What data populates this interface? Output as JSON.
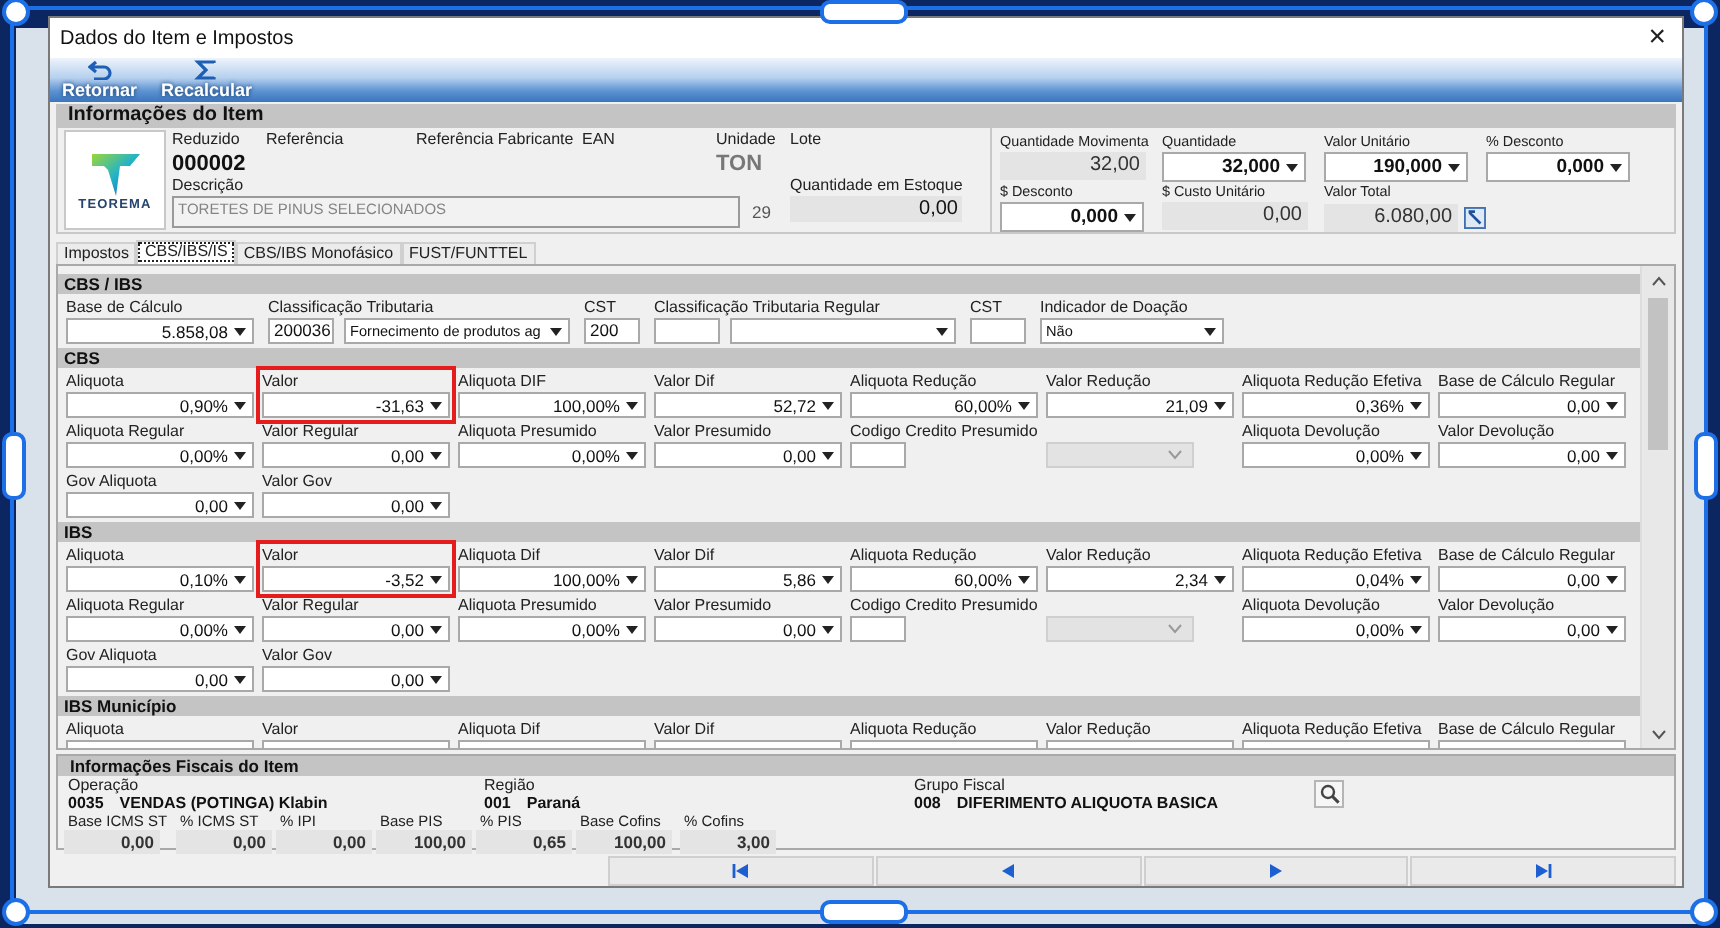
{
  "window": {
    "title": "Dados do Item e Impostos",
    "close": "×"
  },
  "toolbar": [
    {
      "label": "Retornar"
    },
    {
      "label": "Recalcular"
    }
  ],
  "item_info": {
    "title": "Informações do Item",
    "logo": "TEOREMA",
    "reduzido": {
      "label": "Reduzido",
      "value": "000002"
    },
    "referencia": {
      "label": "Referência"
    },
    "referencia_fabricante": {
      "label": "Referência Fabricante"
    },
    "ean": {
      "label": "EAN"
    },
    "unidade": {
      "label": "Unidade",
      "value": "TON"
    },
    "lote": {
      "label": "Lote"
    },
    "descricao": {
      "label": "Descrição",
      "value": "TORETES DE PINUS SELECIONADOS",
      "count": "29"
    },
    "estoque": {
      "label": "Quantidade em Estoque",
      "value": "0,00"
    },
    "amounts": [
      {
        "kind": "readonly",
        "label": "Quantidade Movimenta",
        "value": "32,00"
      },
      {
        "kind": "spin",
        "label": "Quantidade",
        "value": "32,000"
      },
      {
        "kind": "spin",
        "label": "Valor Unitário",
        "value": "190,000"
      },
      {
        "kind": "spin",
        "label": "% Desconto",
        "value": "0,000"
      },
      {
        "kind": "spin",
        "label": "$ Desconto",
        "value": "0,000"
      },
      {
        "kind": "readonly",
        "label": "$ Custo Unitário",
        "value": "0,00"
      },
      {
        "kind": "readonly_action",
        "label": "Valor Total",
        "value": "6.080,00"
      }
    ]
  },
  "tabs": [
    {
      "label": "Impostos",
      "selected": false
    },
    {
      "label": "CBS/IBS/IS",
      "selected": true
    },
    {
      "label": "CBS/IBS Monofásico",
      "selected": false
    },
    {
      "label": "FUST/FUNTTEL",
      "selected": false
    }
  ],
  "sections": [
    {
      "title": "CBS / IBS",
      "rows": [
        [
          {
            "kind": "spin",
            "label": "Base de Cálculo",
            "value": "5.858,08"
          },
          {
            "kind": "code_select",
            "label": "Classificação Tributaria",
            "code": "200036",
            "value": "Fornecimento de produtos ag"
          },
          {
            "kind": "text",
            "label": "CST",
            "value": "200"
          },
          {
            "kind": "code_select",
            "label": "Classificação Tributaria Regular"
          },
          {
            "kind": "text",
            "label": "CST"
          },
          {
            "kind": "select",
            "label": "Indicador de Doação",
            "value": "Não"
          }
        ]
      ]
    },
    {
      "title": "CBS",
      "rows": [
        [
          {
            "kind": "spin",
            "label": "Aliquota",
            "value": "0,90%"
          },
          {
            "kind": "spin",
            "label": "Valor",
            "value": "-31,63",
            "highlighted": true
          },
          {
            "kind": "spin",
            "label": "Aliquota DIF",
            "value": "100,00%"
          },
          {
            "kind": "spin",
            "label": "Valor Dif",
            "value": "52,72"
          },
          {
            "kind": "spin",
            "label": "Aliquota Redução",
            "value": "60,00%"
          },
          {
            "kind": "spin",
            "label": "Valor Redução",
            "value": "21,09"
          },
          {
            "kind": "spin",
            "label": "Aliquota Redução Efetiva",
            "value": "0,36%"
          },
          {
            "kind": "spin",
            "label": "Base de Cálculo Regular",
            "value": "0,00"
          }
        ],
        [
          {
            "kind": "spin",
            "label": "Aliquota Regular",
            "value": "0,00%"
          },
          {
            "kind": "spin",
            "label": "Valor Regular",
            "value": "0,00"
          },
          {
            "kind": "spin",
            "label": "Aliquota Presumido",
            "value": "0,00%"
          },
          {
            "kind": "spin",
            "label": "Valor Presumido",
            "value": "0,00"
          },
          {
            "kind": "text",
            "label": "Codigo Credito Presumido"
          },
          {
            "kind": "combo"
          },
          {
            "kind": "spin",
            "label": "Aliquota Devolução",
            "value": "0,00%"
          },
          {
            "kind": "spin",
            "label": "Valor Devolução",
            "value": "0,00"
          }
        ],
        [
          {
            "kind": "spin",
            "label": "Gov Aliquota",
            "value": "0,00"
          },
          {
            "kind": "spin",
            "label": "Valor Gov",
            "value": "0,00"
          }
        ]
      ]
    },
    {
      "title": "IBS",
      "rows": [
        [
          {
            "kind": "spin",
            "label": "Aliquota",
            "value": "0,10%"
          },
          {
            "kind": "spin",
            "label": "Valor",
            "value": "-3,52",
            "highlighted": true
          },
          {
            "kind": "spin",
            "label": "Aliquota Dif",
            "value": "100,00%"
          },
          {
            "kind": "spin",
            "label": "Valor Dif",
            "value": "5,86"
          },
          {
            "kind": "spin",
            "label": "Aliquota Redução",
            "value": "60,00%"
          },
          {
            "kind": "spin",
            "label": "Valor Redução",
            "value": "2,34"
          },
          {
            "kind": "spin",
            "label": "Aliquota Redução Efetiva",
            "value": "0,04%"
          },
          {
            "kind": "spin",
            "label": "Base de Cálculo Regular",
            "value": "0,00"
          }
        ],
        [
          {
            "kind": "spin",
            "label": "Aliquota Regular",
            "value": "0,00%"
          },
          {
            "kind": "spin",
            "label": "Valor Regular",
            "value": "0,00"
          },
          {
            "kind": "spin",
            "label": "Aliquota Presumido",
            "value": "0,00%"
          },
          {
            "kind": "spin",
            "label": "Valor Presumido",
            "value": "0,00"
          },
          {
            "kind": "text",
            "label": "Codigo Credito Presumido"
          },
          {
            "kind": "combo"
          },
          {
            "kind": "spin",
            "label": "Aliquota Devolução",
            "value": "0,00%"
          },
          {
            "kind": "spin",
            "label": "Valor Devolução",
            "value": "0,00"
          }
        ],
        [
          {
            "kind": "spin",
            "label": "Gov Aliquota",
            "value": "0,00"
          },
          {
            "kind": "spin",
            "label": "Valor Gov",
            "value": "0,00"
          }
        ]
      ]
    },
    {
      "title": "IBS Município",
      "rows": [
        [
          {
            "kind": "spin",
            "label": "Aliquota"
          },
          {
            "kind": "spin",
            "label": "Valor"
          },
          {
            "kind": "spin",
            "label": "Aliquota Dif"
          },
          {
            "kind": "spin",
            "label": "Valor Dif"
          },
          {
            "kind": "spin",
            "label": "Aliquota Redução"
          },
          {
            "kind": "spin",
            "label": "Valor Redução"
          },
          {
            "kind": "spin",
            "label": "Aliquota Redução Efetiva"
          },
          {
            "kind": "spin",
            "label": "Base de Cálculo Regular"
          }
        ]
      ]
    }
  ],
  "fiscal": {
    "title": "Informações Fiscais do Item",
    "groups": [
      {
        "label": "Operação",
        "code": "0035",
        "value": "VENDAS (POTINGA) Klabin"
      },
      {
        "label": "Região",
        "code": "001",
        "value": "Paraná"
      },
      {
        "label": "Grupo Fiscal",
        "code": "008",
        "value": "DIFERIMENTO ALIQUOTA BASICA"
      }
    ],
    "values": [
      {
        "label": "Base ICMS ST",
        "value": "0,00"
      },
      {
        "label": "% ICMS ST",
        "value": "0,00"
      },
      {
        "label": "% IPI",
        "value": "0,00"
      },
      {
        "label": "Base PIS",
        "value": "100,00"
      },
      {
        "label": "% PIS",
        "value": "0,65"
      },
      {
        "label": "Base Cofins",
        "value": "100,00"
      },
      {
        "label": "% Cofins",
        "value": "3,00"
      }
    ]
  }
}
